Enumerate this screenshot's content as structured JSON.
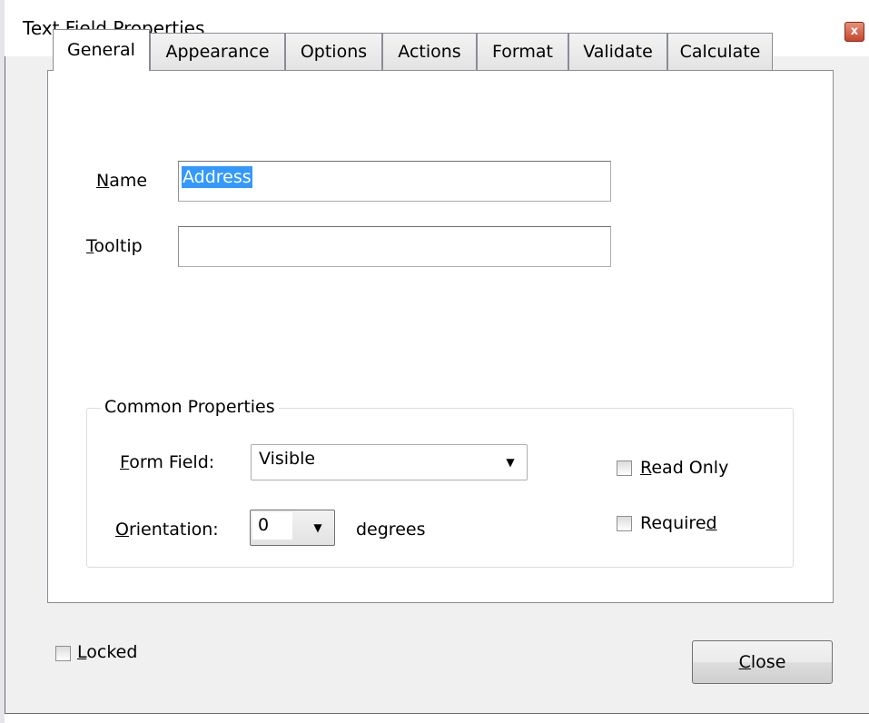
{
  "window": {
    "title": "Text Field Properties",
    "close_glyph": "x"
  },
  "tabs": [
    {
      "label": "General",
      "active": true
    },
    {
      "label": "Appearance",
      "active": false
    },
    {
      "label": "Options",
      "active": false
    },
    {
      "label": "Actions",
      "active": false
    },
    {
      "label": "Format",
      "active": false
    },
    {
      "label": "Validate",
      "active": false
    },
    {
      "label": "Calculate",
      "active": false
    }
  ],
  "general": {
    "name": {
      "mnemonic": "N",
      "rest": "ame",
      "value": "Address"
    },
    "tooltip": {
      "mnemonic": "T",
      "rest": "ooltip",
      "value": ""
    }
  },
  "common_properties": {
    "title": "Common Properties",
    "form_field": {
      "mnemonic": "F",
      "rest": "orm Field:",
      "value": "Visible"
    },
    "orientation": {
      "mnemonic": "O",
      "rest": "rientation:",
      "value": "0",
      "unit": "degrees"
    },
    "read_only": {
      "mnemonic": "R",
      "rest": "ead Only",
      "checked": false
    },
    "required": {
      "prefix": "Require",
      "mnemonic": "d",
      "checked": false
    }
  },
  "footer": {
    "locked": {
      "mnemonic": "L",
      "rest": "ocked",
      "checked": false
    },
    "close": {
      "mnemonic": "C",
      "rest": "lose"
    }
  },
  "icons": {
    "dropdown": "triangle-down",
    "close": "close-x"
  }
}
